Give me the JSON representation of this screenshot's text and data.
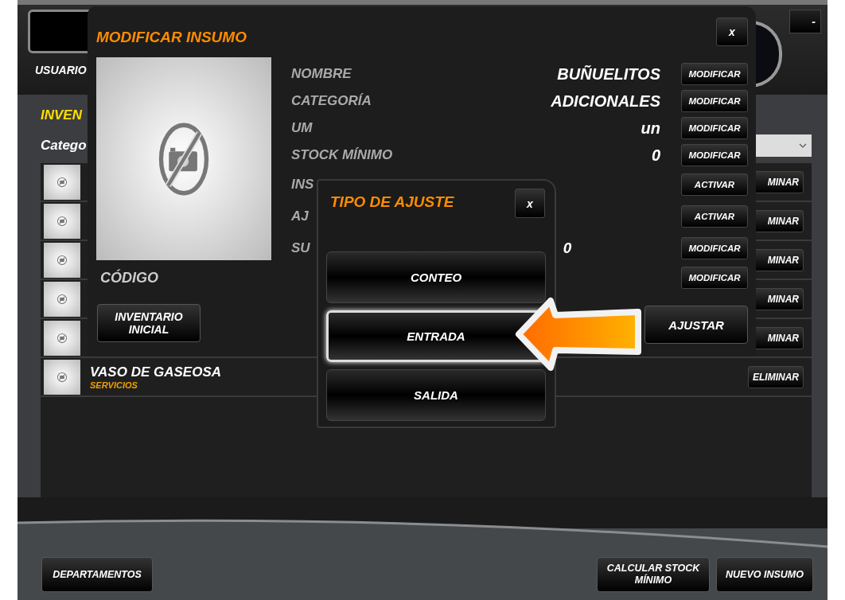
{
  "header": {
    "user_label": "USUARIO",
    "minimize": "-"
  },
  "inventory": {
    "title": "INVEN",
    "category_label": "Catego",
    "rows": [
      {
        "action": "MINAR"
      },
      {
        "action": "MINAR"
      },
      {
        "action": "MINAR"
      },
      {
        "action": "MINAR"
      },
      {
        "action": "MINAR"
      },
      {
        "name": "VASO DE GASEOSA",
        "category": "SERVICIOS",
        "action": "ELIMINAR"
      }
    ]
  },
  "footer": {
    "left_buttons": [
      "DEPARTAMENTOS"
    ],
    "right_buttons": [
      "CALCULAR STOCK MÍNIMO",
      "NUEVO INSUMO"
    ]
  },
  "modify_dialog": {
    "title": "MODIFICAR INSUMO",
    "close": "x",
    "code_label": "CÓDIGO",
    "initial_button": "INVENTARIO INICIAL",
    "adjust_button": "AJUSTAR",
    "fields": [
      {
        "label": "NOMBRE",
        "value": "BUÑUELITOS",
        "button": "MODIFICAR"
      },
      {
        "label": "CATEGORÍA",
        "value": "ADICIONALES",
        "button": "MODIFICAR"
      },
      {
        "label": "UM",
        "value": "un",
        "button": "MODIFICAR"
      },
      {
        "label": "STOCK MÍNIMO",
        "value": "0",
        "button": "MODIFICAR"
      },
      {
        "label": "INS",
        "button": "ACTIVAR"
      },
      {
        "label": "AJ",
        "button": "ACTIVAR"
      },
      {
        "label": "SU",
        "side_value": "0",
        "button": "MODIFICAR"
      },
      {
        "button": "MODIFICAR"
      }
    ]
  },
  "adjust_dialog": {
    "title": "TIPO DE AJUSTE",
    "close": "x",
    "options": [
      {
        "label": "CONTEO",
        "selected": false
      },
      {
        "label": "ENTRADA",
        "selected": true
      },
      {
        "label": "SALIDA",
        "selected": false
      }
    ]
  }
}
